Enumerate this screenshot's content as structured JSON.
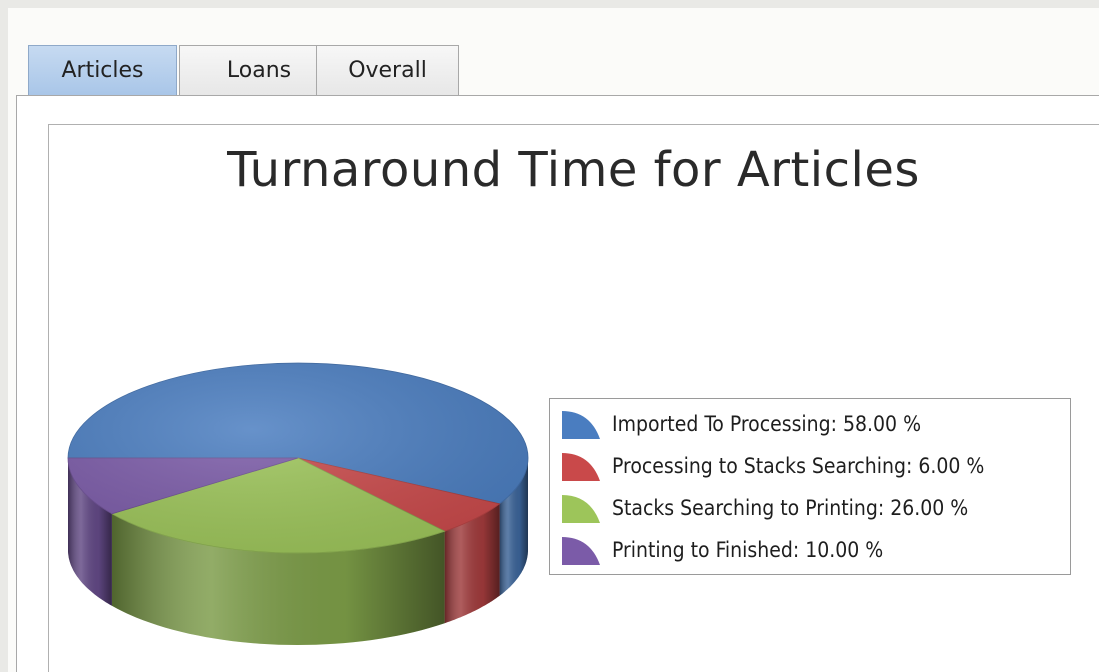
{
  "tabs": [
    {
      "label": "Articles",
      "active": true
    },
    {
      "label": "Loans",
      "active": false
    },
    {
      "label": "Overall",
      "active": false
    }
  ],
  "chart_data": {
    "type": "pie",
    "title": "Turnaround Time for Articles",
    "slices": [
      {
        "label": "Imported To Processing",
        "value": 58.0,
        "color": "#4a7dc0",
        "legend_text": "Imported To Processing: 58.00 %"
      },
      {
        "label": "Processing to Stacks Searching",
        "value": 6.0,
        "color": "#c9494a",
        "legend_text": "Processing to Stacks Searching: 6.00 %"
      },
      {
        "label": "Stacks Searching to Printing",
        "value": 26.0,
        "color": "#9dc55a",
        "legend_text": "Stacks Searching to Printing: 26.00 %"
      },
      {
        "label": "Printing to Finished",
        "value": 10.0,
        "color": "#7b5ba8",
        "legend_text": "Printing to Finished: 10.00 %"
      }
    ],
    "legend_position": "right",
    "style": "3d"
  }
}
